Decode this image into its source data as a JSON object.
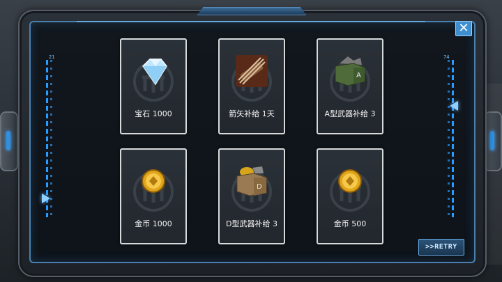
{
  "left_scale_value": "21",
  "right_scale_value": "74",
  "rewards": [
    {
      "label": "宝石 1000",
      "icon": "gem-icon"
    },
    {
      "label": "箭矢补给 1天",
      "icon": "arrow-bundle-icon"
    },
    {
      "label": "A型武器补给 3",
      "icon": "weapon-crate-a-icon"
    },
    {
      "label": "金币 1000",
      "icon": "gold-coin-icon"
    },
    {
      "label": "D型武器补给 3",
      "icon": "weapon-crate-d-icon"
    },
    {
      "label": "金币 500",
      "icon": "gold-coin-icon"
    }
  ],
  "close_label": "✕",
  "retry_label": ">>RETRY",
  "colors": {
    "frame_accent": "#4b7fae",
    "scale_blue": "#2a9cff",
    "card_border": "#d7dadd"
  }
}
